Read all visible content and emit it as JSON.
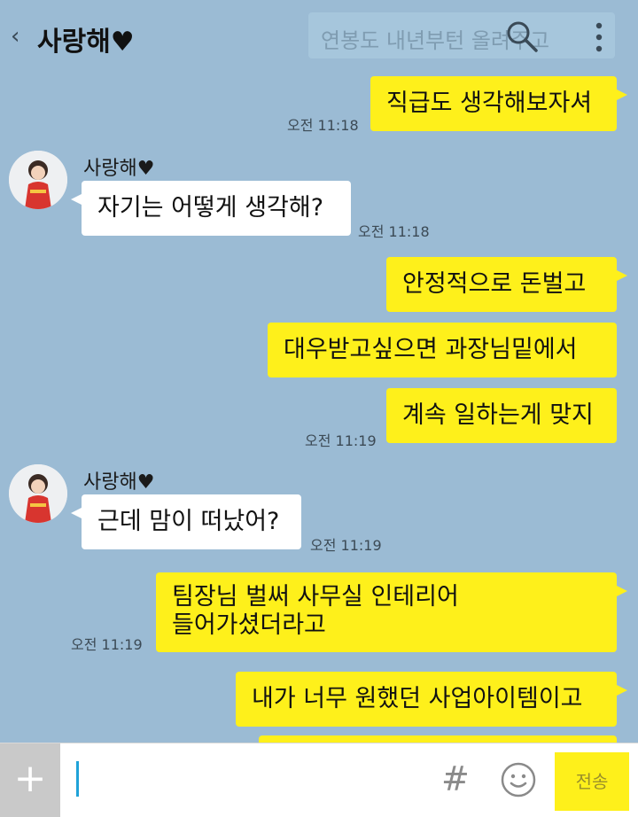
{
  "header": {
    "back_glyph": "‹",
    "title": "사랑해♥",
    "preview": "연봉도 내년부턴 올려주고"
  },
  "messages": [
    {
      "who": "me",
      "text": "직급도 생각해보자셔",
      "time": "오전 11:18"
    },
    {
      "who": "other",
      "sender": "사랑해♥",
      "text": "자기는 어떻게 생각해?",
      "time": "오전 11:18"
    },
    {
      "who": "me",
      "text": "안정적으로 돈벌고"
    },
    {
      "who": "me",
      "text": "대우받고싶으면 과장님밑에서"
    },
    {
      "who": "me",
      "text": "계속 일하는게 맞지",
      "time": "오전 11:19"
    },
    {
      "who": "other",
      "sender": "사랑해♥",
      "text": "근데 맘이 떠났어?",
      "time": "오전 11:19"
    },
    {
      "who": "me",
      "text_line1": "팀장님 벌써 사무실 인테리어",
      "text_line2": "들어가셨더라고",
      "time": "오전 11:19"
    },
    {
      "who": "me",
      "text": "내가 너무 원했던 사업아이템이고"
    }
  ],
  "input": {
    "plus_label": "+",
    "hash_label": "#",
    "send_label": "전송"
  },
  "colors": {
    "background": "#9bbbd4",
    "my_bubble": "#fef01b",
    "other_bubble": "#ffffff"
  },
  "icons": [
    "back-icon",
    "search-icon",
    "more-icon",
    "plus-icon",
    "hash-icon",
    "emoji-icon"
  ]
}
